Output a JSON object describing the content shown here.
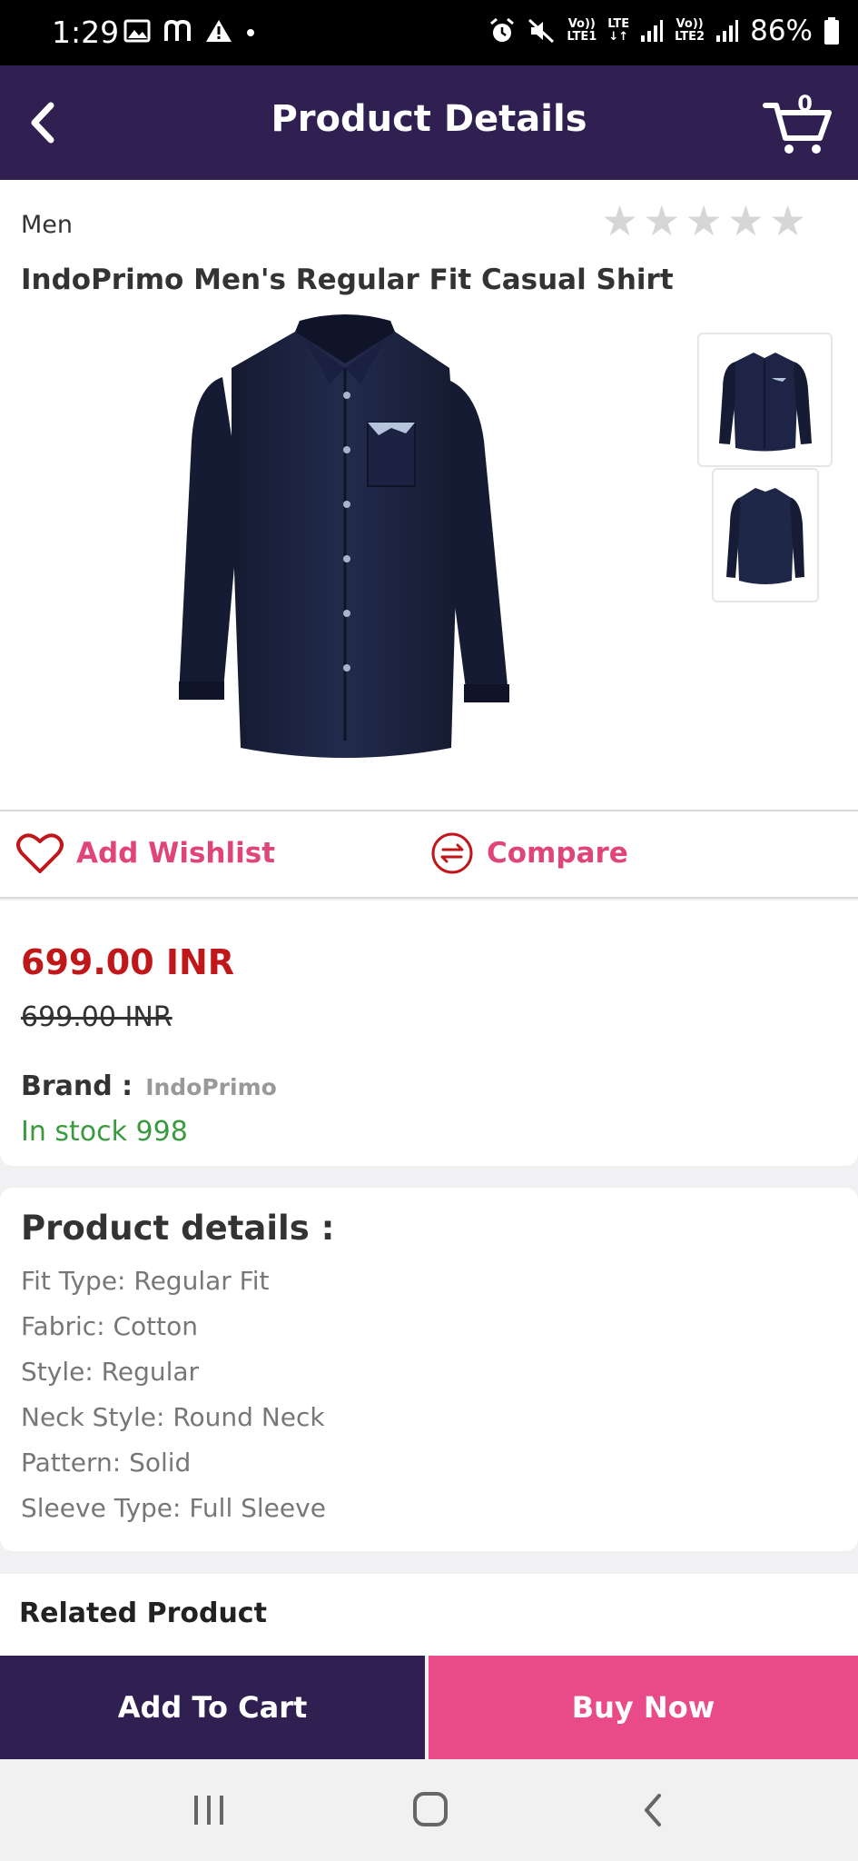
{
  "status_bar": {
    "time": "1:29",
    "battery": "86%",
    "sim1_line1": "Vo))",
    "sim1_line2": "LTE1",
    "lte_label": "LTE",
    "sim2_line1": "Vo))",
    "sim2_line2": "LTE2"
  },
  "app_bar": {
    "title": "Product Details",
    "cart_count": "0"
  },
  "product": {
    "category": "Men",
    "name": "IndoPrimo Men's Regular Fit Casual Shirt",
    "rating": 0,
    "rating_max": 5,
    "image_color": "#1c2340"
  },
  "actions": {
    "wishlist_label": "Add Wishlist",
    "compare_label": "Compare"
  },
  "pricing": {
    "price": "699.00 INR",
    "old_price": "699.00 INR",
    "brand_label": "Brand :",
    "brand_value": "IndoPrimo",
    "stock": "In stock 998"
  },
  "details": {
    "title": "Product details :",
    "items": [
      "Fit Type: Regular Fit",
      "Fabric: Cotton",
      "Style: Regular",
      "Neck Style: Round Neck",
      "Pattern: Solid",
      "Sleeve Type: Full Sleeve"
    ]
  },
  "related": {
    "title": "Related Product"
  },
  "buttons": {
    "add_to_cart": "Add To Cart",
    "buy_now": "Buy Now"
  },
  "colors": {
    "primary": "#2f2051",
    "accent": "#e84b88",
    "price": "#c0181a",
    "stock": "#3a9a3f"
  }
}
